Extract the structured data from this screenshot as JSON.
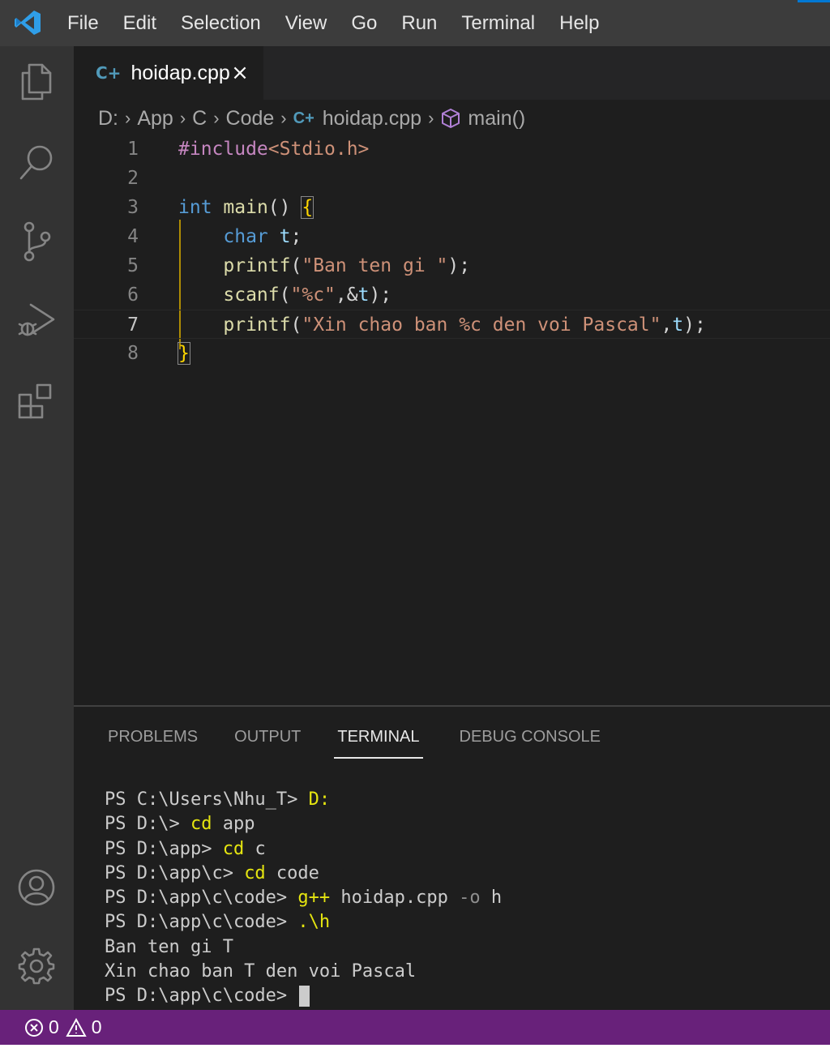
{
  "menu": [
    "File",
    "Edit",
    "Selection",
    "View",
    "Go",
    "Run",
    "Terminal",
    "Help"
  ],
  "tab": {
    "icon": "cpp-file-icon",
    "label": "hoidap.cpp",
    "close": "×"
  },
  "breadcrumb": {
    "items": [
      "D:",
      "App",
      "C",
      "Code"
    ],
    "file": "hoidap.cpp",
    "symbol": "main()"
  },
  "code_lines": [
    {
      "n": "1",
      "parts": [
        [
          "kw-pre",
          "#include"
        ],
        [
          "inc",
          "<Stdio.h>"
        ]
      ]
    },
    {
      "n": "2",
      "parts": []
    },
    {
      "n": "3",
      "parts": [
        [
          "type",
          "int"
        ],
        [
          "punc",
          " "
        ],
        [
          "fn",
          "main"
        ],
        [
          "punc",
          "() "
        ],
        [
          "brace",
          "{"
        ]
      ]
    },
    {
      "n": "4",
      "parts": [
        [
          "punc",
          "    "
        ],
        [
          "type",
          "char"
        ],
        [
          "punc",
          " "
        ],
        [
          "var",
          "t"
        ],
        [
          "punc",
          ";"
        ]
      ]
    },
    {
      "n": "5",
      "parts": [
        [
          "punc",
          "    "
        ],
        [
          "fn",
          "printf"
        ],
        [
          "punc",
          "("
        ],
        [
          "str",
          "\"Ban ten gi \""
        ],
        [
          "punc",
          ");"
        ]
      ]
    },
    {
      "n": "6",
      "parts": [
        [
          "punc",
          "    "
        ],
        [
          "fn",
          "scanf"
        ],
        [
          "punc",
          "("
        ],
        [
          "str",
          "\"%c\""
        ],
        [
          "punc",
          ",&"
        ],
        [
          "var",
          "t"
        ],
        [
          "punc",
          ");"
        ]
      ]
    },
    {
      "n": "7",
      "parts": [
        [
          "punc",
          "    "
        ],
        [
          "fn",
          "printf"
        ],
        [
          "punc",
          "("
        ],
        [
          "str",
          "\"Xin chao ban %c den voi Pascal\""
        ],
        [
          "punc",
          ","
        ],
        [
          "var",
          "t"
        ],
        [
          "punc",
          ");"
        ]
      ]
    },
    {
      "n": "8",
      "parts": [
        [
          "brace",
          "}"
        ]
      ]
    }
  ],
  "current_line": "7",
  "panel_tabs": [
    "PROBLEMS",
    "OUTPUT",
    "TERMINAL",
    "DEBUG CONSOLE"
  ],
  "active_panel_tab": "TERMINAL",
  "terminal_lines": [
    [
      [
        "p",
        "PS C:\\Users\\Nhu_T> "
      ],
      [
        "cmd",
        "D:"
      ]
    ],
    [
      [
        "p",
        "PS D:\\> "
      ],
      [
        "cmd",
        "cd"
      ],
      [
        "p",
        " app"
      ]
    ],
    [
      [
        "p",
        "PS D:\\app> "
      ],
      [
        "cmd",
        "cd"
      ],
      [
        "p",
        " c"
      ]
    ],
    [
      [
        "p",
        "PS D:\\app\\c> "
      ],
      [
        "cmd",
        "cd"
      ],
      [
        "p",
        " code"
      ]
    ],
    [
      [
        "p",
        "PS D:\\app\\c\\code> "
      ],
      [
        "cmd",
        "g++"
      ],
      [
        "p",
        " hoidap.cpp "
      ],
      [
        "flag",
        "-o"
      ],
      [
        "p",
        " h"
      ]
    ],
    [
      [
        "p",
        "PS D:\\app\\c\\code> "
      ],
      [
        "cmd",
        ".\\h"
      ]
    ],
    [
      [
        "p",
        "Ban ten gi T"
      ]
    ],
    [
      [
        "p",
        "Xin chao ban T den voi Pascal"
      ]
    ],
    [
      [
        "p",
        "PS D:\\app\\c\\code> "
      ],
      [
        "cursor",
        ""
      ]
    ]
  ],
  "status": {
    "errors": "0",
    "warnings": "0"
  },
  "colors": {
    "statusbar": "#68217a",
    "titlebar": "#3c3c3c",
    "activitybar": "#333333",
    "editor_bg": "#1e1e1e"
  }
}
